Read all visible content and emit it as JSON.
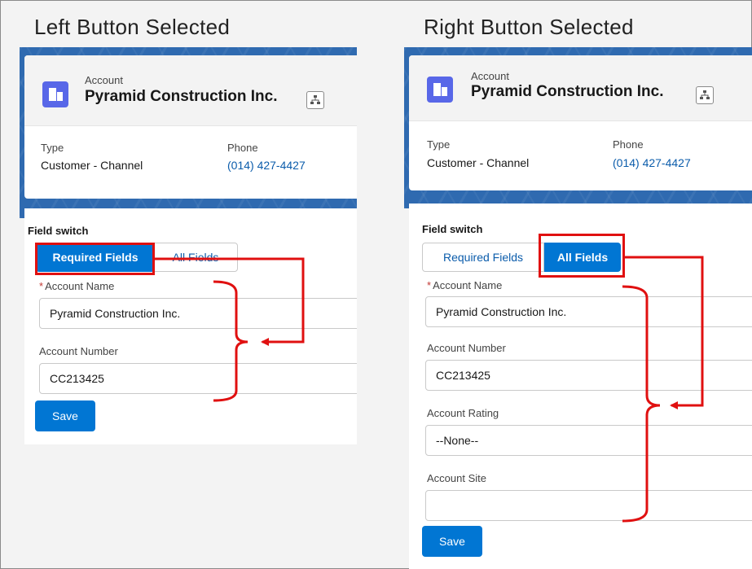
{
  "left": {
    "caption": "Left Button Selected",
    "header": {
      "object_label": "Account",
      "record_name": "Pyramid Construction Inc.",
      "fields": [
        {
          "label": "Type",
          "value": "Customer - Channel"
        },
        {
          "label": "Phone",
          "value": "(014) 427-4427"
        }
      ]
    },
    "form": {
      "switch_title": "Field switch",
      "buttons": [
        {
          "label": "Required Fields",
          "selected": true
        },
        {
          "label": "All Fields",
          "selected": false
        }
      ],
      "inputs": [
        {
          "label": "Account Name",
          "required_mark": "*",
          "value": "Pyramid Construction Inc."
        },
        {
          "label": "Account Number",
          "value": "CC213425"
        }
      ],
      "save_label": "Save"
    }
  },
  "right": {
    "caption": "Right Button Selected",
    "header": {
      "object_label": "Account",
      "record_name": "Pyramid Construction Inc.",
      "fields": [
        {
          "label": "Type",
          "value": "Customer - Channel"
        },
        {
          "label": "Phone",
          "value": "(014) 427-4427"
        }
      ]
    },
    "form": {
      "switch_title": "Field switch",
      "buttons": [
        {
          "label": "Required Fields",
          "selected": false
        },
        {
          "label": "All Fields",
          "selected": true
        }
      ],
      "inputs": [
        {
          "label": "Account Name",
          "required_mark": "*",
          "value": "Pyramid Construction Inc."
        },
        {
          "label": "Account Number",
          "value": "CC213425"
        },
        {
          "label": "Account Rating",
          "value": "--None--"
        },
        {
          "label": "Account Site",
          "value": ""
        }
      ],
      "save_label": "Save"
    }
  },
  "colors": {
    "brand_blue": "#0176d3",
    "link_blue": "#0b5cab",
    "annotation_red": "#e01010",
    "banner_blue": "#2f6ab0",
    "account_icon": "#5867e8"
  }
}
